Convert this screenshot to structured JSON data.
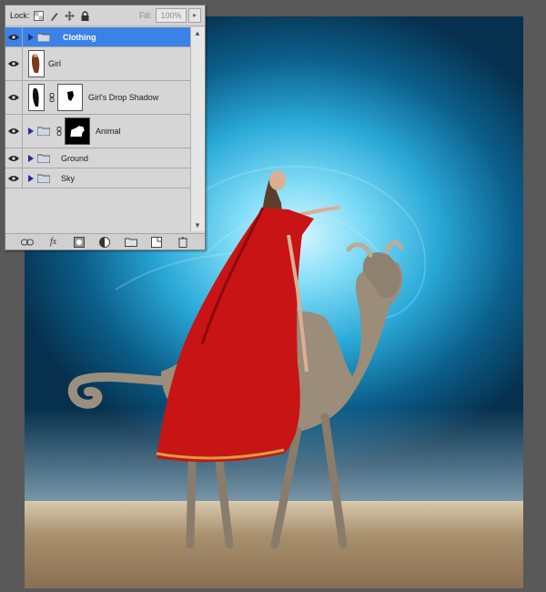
{
  "panel": {
    "lock_label": "Lock:",
    "fill_label": "Fill:",
    "fill_value": "100%",
    "layers": [
      {
        "name": "Clothing",
        "type": "group",
        "selected": true
      },
      {
        "name": "Girl",
        "type": "layer",
        "selected": false
      },
      {
        "name": "Girl's Drop Shadow",
        "type": "layer-mask",
        "selected": false
      },
      {
        "name": "Animal",
        "type": "group-mask",
        "selected": false
      },
      {
        "name": "Ground",
        "type": "group",
        "selected": false
      },
      {
        "name": "Sky",
        "type": "group",
        "selected": false
      }
    ],
    "bottom_icons": [
      "link-icon",
      "fx-icon",
      "add-mask-icon",
      "adjustment-layer-icon",
      "new-group-icon",
      "new-layer-icon",
      "trash-icon"
    ]
  },
  "colors": {
    "selection": "#3b82e6",
    "panel_bg": "#d4d4d4",
    "workspace": "#595959",
    "cape_red": "#c81414"
  }
}
